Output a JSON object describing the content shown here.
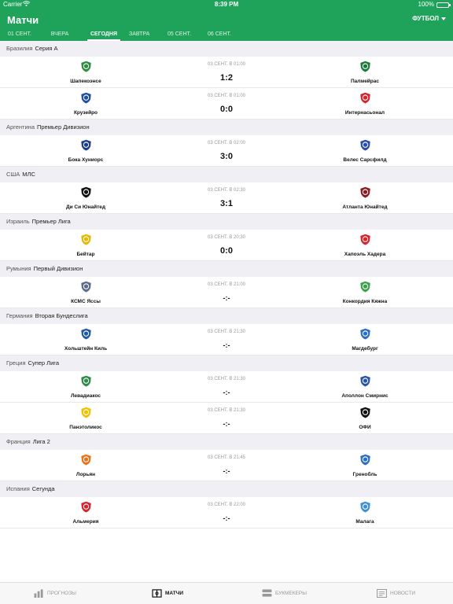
{
  "status_bar": {
    "carrier": "Carrier",
    "time": "8:39 PM",
    "battery": "100%"
  },
  "header": {
    "title": "Матчи",
    "sport": "ФУТБОЛ"
  },
  "tabs": [
    "01 СЕНТ.",
    "ВЧЕРА",
    "СЕГОДНЯ",
    "ЗАВТРА",
    "05 СЕНТ.",
    "06 СЕНТ."
  ],
  "active_tab": "СЕГОДНЯ",
  "leagues": [
    {
      "country": "Бразилия",
      "name": "Серия А",
      "matches": [
        {
          "date": "03 СЕНТ. В 01:00",
          "home": "Шапекоэнсе",
          "away": "Палмейрас",
          "score": "1:2"
        },
        {
          "date": "03 СЕНТ. В 01:00",
          "home": "Крузейро",
          "away": "Интернасьонал",
          "score": "0:0"
        }
      ]
    },
    {
      "country": "Аргентина",
      "name": "Премьер Дивизион",
      "matches": [
        {
          "date": "03 СЕНТ. В 02:00",
          "home": "Бока Хуниорс",
          "away": "Велес Сарсфилд",
          "score": "3:0"
        }
      ]
    },
    {
      "country": "США",
      "name": "МЛС",
      "matches": [
        {
          "date": "03 СЕНТ. В 02:30",
          "home": "Ди Си Юнайтед",
          "away": "Атланта Юнайтед",
          "score": "3:1"
        }
      ]
    },
    {
      "country": "Израиль",
      "name": "Премьер Лига",
      "matches": [
        {
          "date": "03 СЕНТ. В 20:30",
          "home": "Бейтар",
          "away": "Хапоэль Хадера",
          "score": "0:0"
        }
      ]
    },
    {
      "country": "Румыния",
      "name": "Первый Дивизион",
      "matches": [
        {
          "date": "03 СЕНТ. В 21:00",
          "home": "КСМС Яссы",
          "away": "Конкордия Кяжна",
          "score": "-:-"
        }
      ]
    },
    {
      "country": "Германия",
      "name": "Вторая Бундеслига",
      "matches": [
        {
          "date": "03 СЕНТ. В 21:30",
          "home": "Хольштейн Киль",
          "away": "Магдебург",
          "score": "-:-"
        }
      ]
    },
    {
      "country": "Греция",
      "name": "Супер Лига",
      "matches": [
        {
          "date": "03 СЕНТ. В 21:30",
          "home": "Левадиакос",
          "away": "Аполлон Смирнис",
          "score": "-:-"
        },
        {
          "date": "03 СЕНТ. В 21:30",
          "home": "Панэтоликос",
          "away": "ОФИ",
          "score": "-:-"
        }
      ]
    },
    {
      "country": "Франция",
      "name": "Лига 2",
      "matches": [
        {
          "date": "03 СЕНТ. В 21:45",
          "home": "Лорьян",
          "away": "Гренобль",
          "score": "-:-"
        }
      ]
    },
    {
      "country": "Испания",
      "name": "Сегунда",
      "matches": [
        {
          "date": "03 СЕНТ. В 22:00",
          "home": "Альмерия",
          "away": "Малага",
          "score": "-:-"
        }
      ]
    }
  ],
  "logo_colors": {
    "Шапекоэнсе": "#2e8b3e",
    "Палмейрас": "#1b7a3a",
    "Крузейро": "#1e4fa3",
    "Интернасьонал": "#d6232e",
    "Бока Хуниорс": "#1b3f8b",
    "Велес Сарсфилд": "#2c4ea8",
    "Ди Си Юнайтед": "#111111",
    "Атланта Юнайтед": "#8a1c22",
    "Бейтар": "#e6b800",
    "Хапоэль Хадера": "#d8232a",
    "КСМС Яссы": "#5a6b8c",
    "Конкордия Кяжна": "#3aa14a",
    "Хольштейн Киль": "#1f5aa6",
    "Магдебург": "#2a6fc2",
    "Левадиакос": "#2f8a4a",
    "Аполлон Смирнис": "#2855a8",
    "Панэтоликос": "#f2c200",
    "ОФИ": "#111111",
    "Лорьян": "#e8731c",
    "Гренобль": "#2a6fc2",
    "Альмерия": "#d8232a",
    "Малага": "#3d8fd6"
  },
  "bottom_tabs": [
    {
      "label": "ПРОГНОЗЫ",
      "icon": "chart-icon"
    },
    {
      "label": "МАТЧИ",
      "icon": "matches-icon"
    },
    {
      "label": "БУКМЕКЕРЫ",
      "icon": "bookmakers-icon"
    },
    {
      "label": "НОВОСТИ",
      "icon": "news-icon"
    }
  ],
  "active_bottom_tab": "МАТЧИ",
  "colors": {
    "brand": "#1fa35a",
    "section_bg": "#efeff4"
  }
}
